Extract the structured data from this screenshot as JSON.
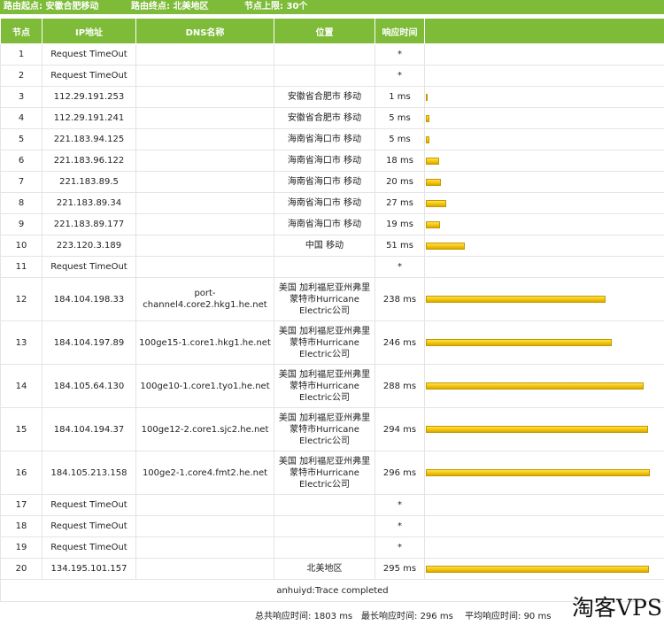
{
  "header": {
    "start_label": "路由起点:",
    "start_value": "安徽合肥移动",
    "end_label": "路由终点:",
    "end_value": "北美地区",
    "limit_label": "节点上限:",
    "limit_value": "30个"
  },
  "columns": [
    "节点",
    "IP地址",
    "DNS名称",
    "位置",
    "响应时间",
    ""
  ],
  "rows": [
    {
      "hop": "1",
      "ip": "Request TimeOut",
      "dns": "",
      "loc": "",
      "time": "*",
      "ms": null
    },
    {
      "hop": "2",
      "ip": "Request TimeOut",
      "dns": "",
      "loc": "",
      "time": "*",
      "ms": null
    },
    {
      "hop": "3",
      "ip": "112.29.191.253",
      "dns": "",
      "loc": "安徽省合肥市 移动",
      "time": "1 ms",
      "ms": 1
    },
    {
      "hop": "4",
      "ip": "112.29.191.241",
      "dns": "",
      "loc": "安徽省合肥市 移动",
      "time": "5 ms",
      "ms": 5
    },
    {
      "hop": "5",
      "ip": "221.183.94.125",
      "dns": "",
      "loc": "海南省海口市 移动",
      "time": "5 ms",
      "ms": 5
    },
    {
      "hop": "6",
      "ip": "221.183.96.122",
      "dns": "",
      "loc": "海南省海口市 移动",
      "time": "18 ms",
      "ms": 18
    },
    {
      "hop": "7",
      "ip": "221.183.89.5",
      "dns": "",
      "loc": "海南省海口市 移动",
      "time": "20 ms",
      "ms": 20
    },
    {
      "hop": "8",
      "ip": "221.183.89.34",
      "dns": "",
      "loc": "海南省海口市 移动",
      "time": "27 ms",
      "ms": 27
    },
    {
      "hop": "9",
      "ip": "221.183.89.177",
      "dns": "",
      "loc": "海南省海口市 移动",
      "time": "19 ms",
      "ms": 19
    },
    {
      "hop": "10",
      "ip": "223.120.3.189",
      "dns": "",
      "loc": "中国 移动",
      "time": "51 ms",
      "ms": 51
    },
    {
      "hop": "11",
      "ip": "Request TimeOut",
      "dns": "",
      "loc": "",
      "time": "*",
      "ms": null
    },
    {
      "hop": "12",
      "ip": "184.104.198.33",
      "dns": "port-channel4.core2.hkg1.he.net",
      "loc": "美国 加利福尼亚州弗里蒙特市Hurricane Electric公司",
      "time": "238 ms",
      "ms": 238
    },
    {
      "hop": "13",
      "ip": "184.104.197.89",
      "dns": "100ge15-1.core1.hkg1.he.net",
      "loc": "美国 加利福尼亚州弗里蒙特市Hurricane Electric公司",
      "time": "246 ms",
      "ms": 246
    },
    {
      "hop": "14",
      "ip": "184.105.64.130",
      "dns": "100ge10-1.core1.tyo1.he.net",
      "loc": "美国 加利福尼亚州弗里蒙特市Hurricane Electric公司",
      "time": "288 ms",
      "ms": 288
    },
    {
      "hop": "15",
      "ip": "184.104.194.37",
      "dns": "100ge12-2.core1.sjc2.he.net",
      "loc": "美国 加利福尼亚州弗里蒙特市Hurricane Electric公司",
      "time": "294 ms",
      "ms": 294
    },
    {
      "hop": "16",
      "ip": "184.105.213.158",
      "dns": "100ge2-1.core4.fmt2.he.net",
      "loc": "美国 加利福尼亚州弗里蒙特市Hurricane Electric公司",
      "time": "296 ms",
      "ms": 296
    },
    {
      "hop": "17",
      "ip": "Request TimeOut",
      "dns": "",
      "loc": "",
      "time": "*",
      "ms": null
    },
    {
      "hop": "18",
      "ip": "Request TimeOut",
      "dns": "",
      "loc": "",
      "time": "*",
      "ms": null
    },
    {
      "hop": "19",
      "ip": "Request TimeOut",
      "dns": "",
      "loc": "",
      "time": "*",
      "ms": null
    },
    {
      "hop": "20",
      "ip": "134.195.101.157",
      "dns": "",
      "loc": "北美地区",
      "time": "295 ms",
      "ms": 295
    }
  ],
  "footer": {
    "completed": "anhuiyd:Trace completed",
    "total_label": "总共响应时间:",
    "total_value": "1803 ms",
    "max_label": "最长响应时间:",
    "max_value": "296 ms",
    "avg_label": "平均响应时间:",
    "avg_value": "90 ms"
  },
  "watermark": "淘客VPS",
  "colors": {
    "header_green": "#7dbb38",
    "bar_yellow": "#f2c40c"
  }
}
